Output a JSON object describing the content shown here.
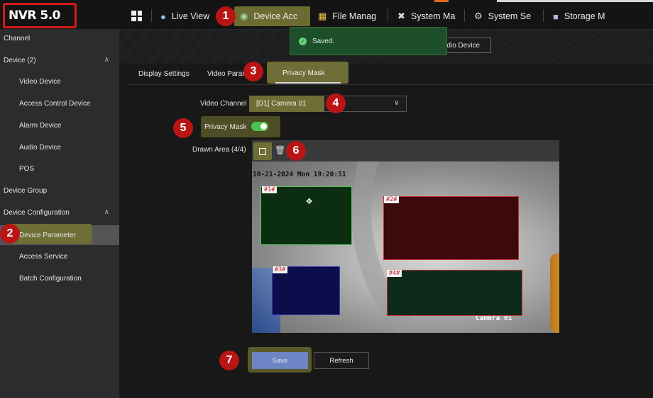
{
  "app": {
    "logo": "NVR 5.0"
  },
  "nav": {
    "tabs": [
      {
        "label": "Live View",
        "icon": "camera-icon"
      },
      {
        "label": "Device Acc",
        "icon": "device-icon"
      },
      {
        "label": "File Manag",
        "icon": "folder-icon"
      },
      {
        "label": "System Ma",
        "icon": "tools-icon"
      },
      {
        "label": "System Se",
        "icon": "gear-icon"
      },
      {
        "label": "Storage M",
        "icon": "storage-icon"
      }
    ]
  },
  "sidebar": {
    "items": [
      {
        "label": "Channel"
      },
      {
        "label": "Device (2)"
      },
      {
        "label": "Video Device"
      },
      {
        "label": "Access Control Device"
      },
      {
        "label": "Alarm Device"
      },
      {
        "label": "Audio Device"
      },
      {
        "label": "POS"
      },
      {
        "label": "Device Group"
      },
      {
        "label": "Device Configuration"
      },
      {
        "label": "Device Parameter"
      },
      {
        "label": "Access Service"
      },
      {
        "label": "Batch Configuration"
      }
    ]
  },
  "header": {
    "audio_button": "udio Device"
  },
  "toast": {
    "message": "Saved."
  },
  "subtabs": [
    "Display Settings",
    "Video Parameters",
    "Privacy Mask"
  ],
  "form": {
    "video_channel_label": "Video Channel",
    "video_channel_value": "[D1] Camera 01",
    "privacy_mask_label": "Privacy Mask",
    "privacy_mask_enabled": true,
    "drawn_area_label": "Drawn Area (4/4)"
  },
  "video": {
    "timestamp": "10-21-2024 Mon 19:20:51",
    "camera_name": "Camera 01",
    "masks": [
      {
        "tag": "#1#",
        "color": "#0b2e12",
        "border": "#53c55c"
      },
      {
        "tag": "#2#",
        "color": "#3c0a0c",
        "border": "#c0322e"
      },
      {
        "tag": "#3#",
        "color": "#0b0e4a",
        "border": "#3a3fb0"
      },
      {
        "tag": "#4#",
        "color": "#0e2a1a",
        "border": "#c0322e"
      }
    ]
  },
  "buttons": {
    "save": "Save",
    "refresh": "Refresh"
  },
  "steps": [
    "1",
    "2",
    "3",
    "4",
    "5",
    "6",
    "7"
  ],
  "colors": {
    "highlight": "#6e6e36",
    "step_badge": "#b91515",
    "toggle_on": "#4cc24e",
    "save_button": "#6d84c5"
  }
}
